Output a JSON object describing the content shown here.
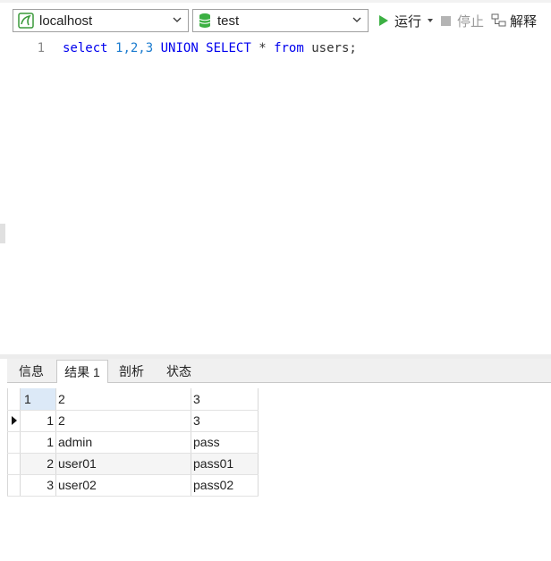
{
  "toolbar": {
    "connection": {
      "value": "localhost",
      "icon": "mysql-connection-icon"
    },
    "database": {
      "value": "test",
      "icon": "database-icon"
    },
    "run_label": "运行",
    "stop_label": "停止",
    "explain_label": "解释"
  },
  "editor": {
    "line_numbers": [
      "1"
    ],
    "sql_parts": {
      "kw_select": "select",
      "nums": "1,2,3",
      "kw_union": "UNION SELECT",
      "star": "*",
      "kw_from": "from",
      "table": "users;"
    }
  },
  "result_tabs": [
    {
      "label": "信息"
    },
    {
      "label": "结果 1"
    },
    {
      "label": "剖析"
    },
    {
      "label": "状态"
    }
  ],
  "grid": {
    "columns": [
      "1",
      "2",
      "3"
    ],
    "rows": [
      [
        "1",
        "2",
        "3"
      ],
      [
        "1",
        "admin",
        "pass"
      ],
      [
        "2",
        "user01",
        "pass01"
      ],
      [
        "3",
        "user02",
        "pass02"
      ]
    ]
  },
  "colors": {
    "run_green": "#3cb043",
    "stop_gray": "#b4b4b4",
    "header_selected": "#dce9f7"
  }
}
